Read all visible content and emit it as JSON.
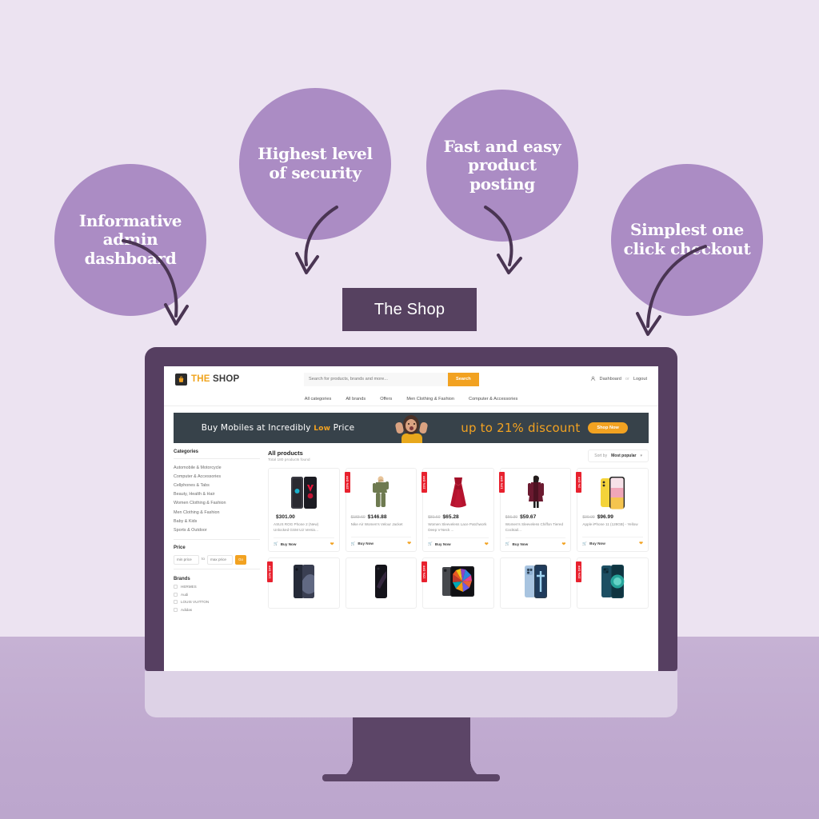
{
  "promo": {
    "bubbles": [
      {
        "id": "dashboard",
        "text": "Informative admin dashboard"
      },
      {
        "id": "security",
        "text": "Highest level of security"
      },
      {
        "id": "posting",
        "text": "Fast and easy product posting"
      },
      {
        "id": "checkout",
        "text": "Simplest one click checkout"
      }
    ],
    "center_label": "The Shop"
  },
  "colors": {
    "background": "#ece3f1",
    "background_bottom": "#c6b2d4",
    "bubble": "#ab8cc4",
    "monitor_bezel": "#563f61",
    "monitor_chin": "#ddd2e6",
    "accent_orange": "#f2a221",
    "badge_red": "#e8212e",
    "banner_dark": "#37424a",
    "center_label_bg": "#564160"
  },
  "site": {
    "logo": {
      "the": "THE",
      "shop": "SHOP",
      "icon": "shopping-bag-icon"
    },
    "search": {
      "placeholder": "Search for products, brands and more...",
      "value": "",
      "button": "Search"
    },
    "account": {
      "icon": "user-icon",
      "dashboard": "Dashboard",
      "separator": "or",
      "logout": "Logout"
    },
    "nav": [
      "All categories",
      "All brands",
      "Offers",
      "Men Clothing & Fashion",
      "Computer & Accessories"
    ],
    "banner": {
      "headline_pre": "Buy Mobiles at Incredibly ",
      "headline_low": "Low",
      "headline_post": " Price",
      "discount": "up to 21% discount",
      "cta": "Shop Now"
    },
    "sidebar": {
      "categories_title": "Categories",
      "categories": [
        "Automobile & Motorcycle",
        "Computer & Accessories",
        "Cellphones & Tabs",
        "Beauty, Health & Hair",
        "Women Clothing & Fashion",
        "Men Clothing & Fashion",
        "Baby & Kids",
        "Sports & Outdoor"
      ],
      "price_title": "Price",
      "price_min_placeholder": "min price",
      "price_to": "to",
      "price_max_placeholder": "max price",
      "price_go": "Go",
      "brands_title": "Brands",
      "brands": [
        "HERMES",
        "Audi",
        "LOUIS VUITTON",
        "Adidas"
      ]
    },
    "main": {
      "title": "All products",
      "subtitle": "Total 180 products found",
      "sort_label": "Sort by",
      "sort_value": "Most popular",
      "sort_caret": "chevron-down-icon",
      "buy_now": "Buy Now",
      "heart": "wishlist-heart-icon",
      "cart": "cart-icon",
      "products": [
        {
          "badge": "",
          "price": "$301.00",
          "old_price": "",
          "name": "ASUS ROG Phone 2 (New) Unlocked GSM U2 Versio...",
          "art": "phone-asus"
        },
        {
          "badge": "20% OFF",
          "price": "$146.88",
          "old_price": "$183.60",
          "name": "Nike Air Women's Velour Jacket",
          "art": "jacket-green"
        },
        {
          "badge": "20% OFF",
          "price": "$65.28",
          "old_price": "$81.60",
          "name": "Women Sleeveless Lace Patchwork Deep V-Neck ...",
          "art": "dress-red"
        },
        {
          "badge": "10% OFF",
          "price": "$59.67",
          "old_price": "$66.30",
          "name": "Women's Sleeveless Chiffon Tiered Cocktail...",
          "art": "coat-maroon"
        },
        {
          "badge": "3% OFF",
          "price": "$96.99",
          "old_price": "$99.99",
          "name": "Apple iPhone 11 (128GB) - Yellow",
          "art": "phone-yellow"
        },
        {
          "badge": "10% OFF",
          "price": "",
          "old_price": "",
          "name": "",
          "art": "phone-dark-blue"
        },
        {
          "badge": "",
          "price": "",
          "old_price": "",
          "name": "",
          "art": "phone-black"
        },
        {
          "badge": "15% OFF",
          "price": "",
          "old_price": "",
          "name": "",
          "art": "tablet-pro"
        },
        {
          "badge": "",
          "price": "",
          "old_price": "",
          "name": "",
          "art": "phone-sierra-blue"
        },
        {
          "badge": "20% OFF",
          "price": "",
          "old_price": "",
          "name": "",
          "art": "phone-teal"
        }
      ]
    }
  }
}
